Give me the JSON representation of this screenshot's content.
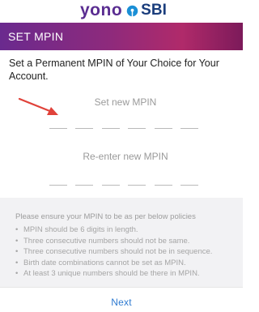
{
  "brand": {
    "yono": "yono",
    "sbi": "SBI",
    "sbi_mark_icon": "sbi-keyhole-logo",
    "colors": {
      "yono": "#5a2d91",
      "sbi": "#1a3d7c"
    }
  },
  "header": {
    "title": "SET MPIN",
    "gradient": [
      "#6a2a8e",
      "#8e2a7c",
      "#b02a6a",
      "#7c1a5a"
    ]
  },
  "intro_text": "Set a Permanent MPIN of Your Choice for Your Account.",
  "annotation": {
    "icon": "red-arrow-icon",
    "color": "#e0423a"
  },
  "mpin": {
    "new_label": "Set new MPIN",
    "reenter_label": "Re-enter new MPIN",
    "digit_count": 6,
    "new_digits": [
      "",
      "",
      "",
      "",
      "",
      ""
    ],
    "reenter_digits": [
      "",
      "",
      "",
      "",
      "",
      ""
    ]
  },
  "policy": {
    "heading": "Please ensure your MPIN to be as per below policies",
    "items": [
      "MPIN should be 6 digits in length.",
      "Three consecutive numbers should not be same.",
      "Three consecutive numbers should not be in sequence.",
      "Birth date combinations cannot be set as MPIN.",
      "At least 3 unique numbers should be there in MPIN."
    ]
  },
  "actions": {
    "next_label": "Next",
    "accent": "#2f7bd1"
  }
}
